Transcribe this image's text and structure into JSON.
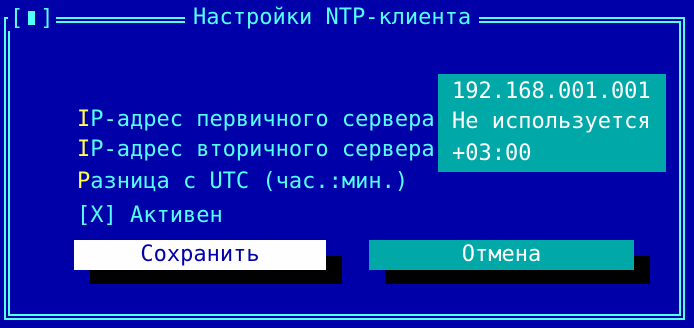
{
  "dialog": {
    "title": "Настройки NTP-клиента",
    "close_open": "[",
    "close_close": "]"
  },
  "fields": [
    {
      "hot": "I",
      "rest": "P-адрес первичного сервера",
      "value": "192.168.001.001"
    },
    {
      "hot": "I",
      "rest": "P-адрес вторичного сервера",
      "value": "Не используется"
    },
    {
      "hot": "Р",
      "rest": "азница с UTC (час.:мин.)",
      "value": "+03:00"
    }
  ],
  "checkbox": {
    "box": "[X]",
    "label": "Активен"
  },
  "buttons": {
    "save": "Сохранить",
    "cancel": "Отмена"
  },
  "colors": {
    "background": "#0000a8",
    "frame": "#53fefe",
    "hotkey": "#fefe55",
    "value_panel": "#00a8a8",
    "button_focused": "#fefefe",
    "button_normal": "#00a8a8"
  }
}
